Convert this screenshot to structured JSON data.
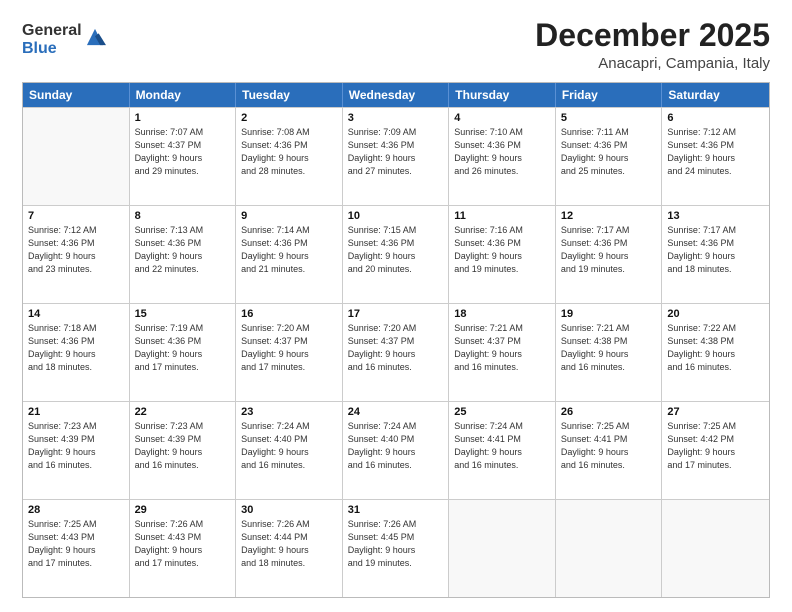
{
  "header": {
    "logo_general": "General",
    "logo_blue": "Blue",
    "main_title": "December 2025",
    "sub_title": "Anacapri, Campania, Italy"
  },
  "calendar": {
    "days_of_week": [
      "Sunday",
      "Monday",
      "Tuesday",
      "Wednesday",
      "Thursday",
      "Friday",
      "Saturday"
    ],
    "weeks": [
      [
        {
          "day": "",
          "info": ""
        },
        {
          "day": "1",
          "info": "Sunrise: 7:07 AM\nSunset: 4:37 PM\nDaylight: 9 hours\nand 29 minutes."
        },
        {
          "day": "2",
          "info": "Sunrise: 7:08 AM\nSunset: 4:36 PM\nDaylight: 9 hours\nand 28 minutes."
        },
        {
          "day": "3",
          "info": "Sunrise: 7:09 AM\nSunset: 4:36 PM\nDaylight: 9 hours\nand 27 minutes."
        },
        {
          "day": "4",
          "info": "Sunrise: 7:10 AM\nSunset: 4:36 PM\nDaylight: 9 hours\nand 26 minutes."
        },
        {
          "day": "5",
          "info": "Sunrise: 7:11 AM\nSunset: 4:36 PM\nDaylight: 9 hours\nand 25 minutes."
        },
        {
          "day": "6",
          "info": "Sunrise: 7:12 AM\nSunset: 4:36 PM\nDaylight: 9 hours\nand 24 minutes."
        }
      ],
      [
        {
          "day": "7",
          "info": "Sunrise: 7:12 AM\nSunset: 4:36 PM\nDaylight: 9 hours\nand 23 minutes."
        },
        {
          "day": "8",
          "info": "Sunrise: 7:13 AM\nSunset: 4:36 PM\nDaylight: 9 hours\nand 22 minutes."
        },
        {
          "day": "9",
          "info": "Sunrise: 7:14 AM\nSunset: 4:36 PM\nDaylight: 9 hours\nand 21 minutes."
        },
        {
          "day": "10",
          "info": "Sunrise: 7:15 AM\nSunset: 4:36 PM\nDaylight: 9 hours\nand 20 minutes."
        },
        {
          "day": "11",
          "info": "Sunrise: 7:16 AM\nSunset: 4:36 PM\nDaylight: 9 hours\nand 19 minutes."
        },
        {
          "day": "12",
          "info": "Sunrise: 7:17 AM\nSunset: 4:36 PM\nDaylight: 9 hours\nand 19 minutes."
        },
        {
          "day": "13",
          "info": "Sunrise: 7:17 AM\nSunset: 4:36 PM\nDaylight: 9 hours\nand 18 minutes."
        }
      ],
      [
        {
          "day": "14",
          "info": "Sunrise: 7:18 AM\nSunset: 4:36 PM\nDaylight: 9 hours\nand 18 minutes."
        },
        {
          "day": "15",
          "info": "Sunrise: 7:19 AM\nSunset: 4:36 PM\nDaylight: 9 hours\nand 17 minutes."
        },
        {
          "day": "16",
          "info": "Sunrise: 7:20 AM\nSunset: 4:37 PM\nDaylight: 9 hours\nand 17 minutes."
        },
        {
          "day": "17",
          "info": "Sunrise: 7:20 AM\nSunset: 4:37 PM\nDaylight: 9 hours\nand 16 minutes."
        },
        {
          "day": "18",
          "info": "Sunrise: 7:21 AM\nSunset: 4:37 PM\nDaylight: 9 hours\nand 16 minutes."
        },
        {
          "day": "19",
          "info": "Sunrise: 7:21 AM\nSunset: 4:38 PM\nDaylight: 9 hours\nand 16 minutes."
        },
        {
          "day": "20",
          "info": "Sunrise: 7:22 AM\nSunset: 4:38 PM\nDaylight: 9 hours\nand 16 minutes."
        }
      ],
      [
        {
          "day": "21",
          "info": "Sunrise: 7:23 AM\nSunset: 4:39 PM\nDaylight: 9 hours\nand 16 minutes."
        },
        {
          "day": "22",
          "info": "Sunrise: 7:23 AM\nSunset: 4:39 PM\nDaylight: 9 hours\nand 16 minutes."
        },
        {
          "day": "23",
          "info": "Sunrise: 7:24 AM\nSunset: 4:40 PM\nDaylight: 9 hours\nand 16 minutes."
        },
        {
          "day": "24",
          "info": "Sunrise: 7:24 AM\nSunset: 4:40 PM\nDaylight: 9 hours\nand 16 minutes."
        },
        {
          "day": "25",
          "info": "Sunrise: 7:24 AM\nSunset: 4:41 PM\nDaylight: 9 hours\nand 16 minutes."
        },
        {
          "day": "26",
          "info": "Sunrise: 7:25 AM\nSunset: 4:41 PM\nDaylight: 9 hours\nand 16 minutes."
        },
        {
          "day": "27",
          "info": "Sunrise: 7:25 AM\nSunset: 4:42 PM\nDaylight: 9 hours\nand 17 minutes."
        }
      ],
      [
        {
          "day": "28",
          "info": "Sunrise: 7:25 AM\nSunset: 4:43 PM\nDaylight: 9 hours\nand 17 minutes."
        },
        {
          "day": "29",
          "info": "Sunrise: 7:26 AM\nSunset: 4:43 PM\nDaylight: 9 hours\nand 17 minutes."
        },
        {
          "day": "30",
          "info": "Sunrise: 7:26 AM\nSunset: 4:44 PM\nDaylight: 9 hours\nand 18 minutes."
        },
        {
          "day": "31",
          "info": "Sunrise: 7:26 AM\nSunset: 4:45 PM\nDaylight: 9 hours\nand 19 minutes."
        },
        {
          "day": "",
          "info": ""
        },
        {
          "day": "",
          "info": ""
        },
        {
          "day": "",
          "info": ""
        }
      ]
    ]
  }
}
